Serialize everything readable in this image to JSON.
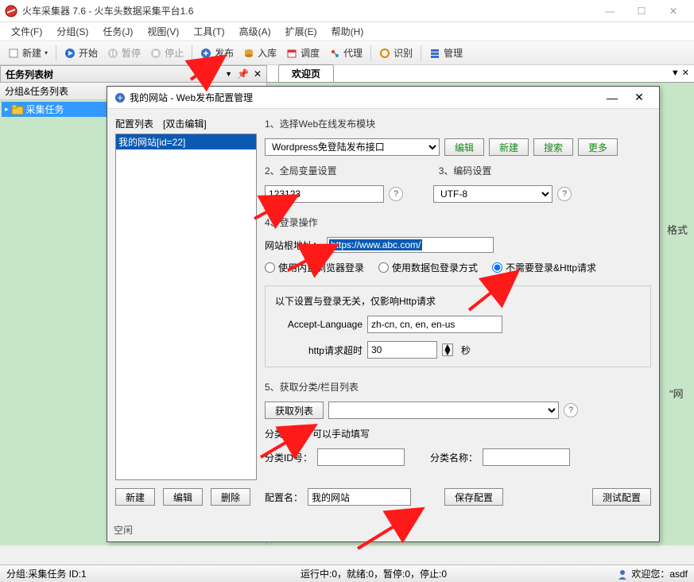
{
  "window": {
    "title": "火车采集器 7.6 - 火车头数据采集平台1.6"
  },
  "menu": {
    "file": "文件(F)",
    "group": "分组(S)",
    "task": "任务(J)",
    "view": "视图(V)",
    "tools": "工具(T)",
    "advanced": "高级(A)",
    "extend": "扩展(E)",
    "help": "帮助(H)"
  },
  "toolbar": {
    "new": "新建",
    "start": "开始",
    "pause": "暂停",
    "stop": "停止",
    "publish": "发布",
    "import_db": "入库",
    "schedule": "调度",
    "proxy": "代理",
    "recognize": "识别",
    "manage": "管理"
  },
  "dock": {
    "tree_header": "任务列表树",
    "group_header": "分组&任务列表",
    "tree_node": "采集任务",
    "welcome_tab": "欢迎页"
  },
  "dialog": {
    "title": "我的网站 - Web发布配置管理",
    "config_list_label": "配置列表　[双击编辑]",
    "config_item": "我的网站[id=22]",
    "s1": "1、选择Web在线发布模块",
    "module": "Wordpress免登陆发布接口",
    "edit": "编辑",
    "new": "新建",
    "search": "搜索",
    "more": "更多",
    "s2": "2、全局变量设置",
    "global_val": "123123",
    "s3": "3、编码设置",
    "encoding": "UTF-8",
    "s4": "4、登录操作",
    "root_label": "网站根地址：",
    "root_url": "https://www.abc.com/",
    "r1": "使用内置浏览器登录",
    "r2": "使用数据包登录方式",
    "r3": "不需要登录&Http请求",
    "inner_note": "以下设置与登录无关，仅影响Http请求",
    "al_label": "Accept-Language",
    "al_val": "zh-cn, cn, en, en-us",
    "timeout_label": "http请求超时",
    "timeout_val": "30",
    "timeout_unit": "秒",
    "s5": "5、获取分类/栏目列表",
    "get_list": "获取列表",
    "cat_note": "分类信息，可以手动填写",
    "cat_id": "分类ID号：",
    "cat_name": "分类名称：",
    "btn_new": "新建",
    "btn_edit": "编辑",
    "btn_del": "删除",
    "cfg_name_label": "配置名：",
    "cfg_name_val": "我的网站",
    "save_cfg": "保存配置",
    "test_cfg": "测试配置",
    "idle": "空闲"
  },
  "bg": {
    "fmt": "格式",
    "quote": "\"网"
  },
  "status": {
    "left": "分组:采集任务  ID:1",
    "center": "运行中:0，就绪:0，暂停:0，停止:0",
    "right": "欢迎您：asdf"
  }
}
